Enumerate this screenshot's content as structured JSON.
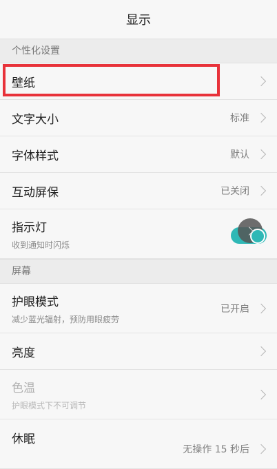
{
  "header": {
    "title": "显示"
  },
  "sections": {
    "personalization": {
      "label": "个性化设置",
      "wallpaper": {
        "label": "壁纸"
      },
      "font_size": {
        "label": "文字大小",
        "value": "标准"
      },
      "font_style": {
        "label": "字体样式",
        "value": "默认"
      },
      "interactive_screensaver": {
        "label": "互动屏保",
        "value": "已关闭"
      },
      "indicator_light": {
        "label": "指示灯",
        "sub": "收到通知时闪烁",
        "enabled": true
      }
    },
    "screen": {
      "label": "屏幕",
      "eye_care": {
        "label": "护眼模式",
        "sub": "减少蓝光辐射，预防用眼疲劳",
        "value": "已开启"
      },
      "brightness": {
        "label": "亮度"
      },
      "color_temp": {
        "label": "色温",
        "sub": "护眼模式下不可调节"
      },
      "sleep": {
        "label": "休眠",
        "value": "无操作 15 秒后"
      }
    }
  },
  "colors": {
    "accent": "#2fb8b6",
    "highlight_box": "#e8323a"
  }
}
